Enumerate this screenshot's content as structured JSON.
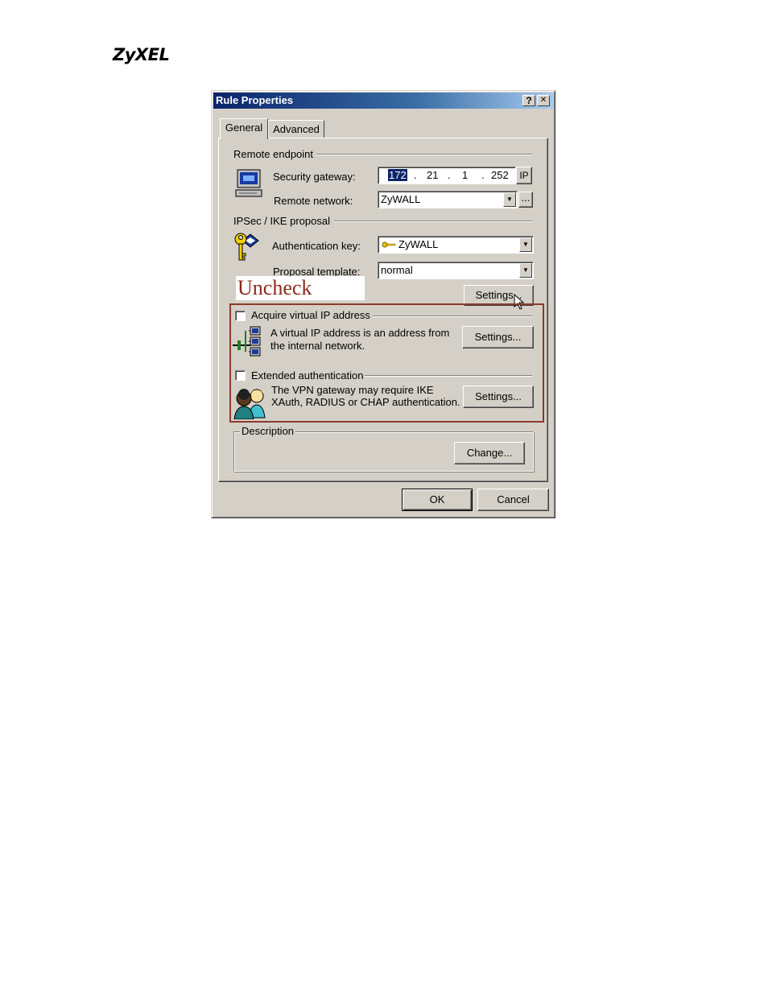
{
  "brand": {
    "logo": "ZyXEL"
  },
  "dialog": {
    "title": "Rule Properties",
    "help_glyph": "?",
    "close_glyph": "✕",
    "tabs": [
      {
        "label": "General",
        "active": true
      },
      {
        "label": "Advanced",
        "active": false
      }
    ],
    "remote_endpoint": {
      "group_label": "Remote endpoint",
      "security_gateway_label": "Security gateway:",
      "ip_octets": [
        "172",
        "21",
        "1",
        "252"
      ],
      "ip_separator": ".",
      "ip_type_label": "IP",
      "remote_network_label": "Remote network:",
      "remote_network_value": "ZyWALL",
      "browse_label": "..."
    },
    "ipsec": {
      "group_label": "IPSec / IKE proposal",
      "auth_key_label": "Authentication key:",
      "auth_key_value": "ZyWALL",
      "proposal_label": "Proposal template:",
      "proposal_value": "normal",
      "settings_label": "Settings..."
    },
    "annotation": {
      "text": "Uncheck",
      "color": "#8b2a1f"
    },
    "virtual_ip": {
      "checkbox_label": "Acquire virtual IP address",
      "checked": false,
      "description_line1": "A virtual IP address is an address from",
      "description_line2": "the internal network.",
      "settings_label": "Settings..."
    },
    "xauth": {
      "checkbox_label": "Extended authentication",
      "checked": false,
      "description_line1": "The VPN gateway may require IKE",
      "description_line2": "XAuth, RADIUS or CHAP authentication.",
      "settings_label": "Settings..."
    },
    "description": {
      "group_label": "Description",
      "change_label": "Change..."
    },
    "footer": {
      "ok_label": "OK",
      "cancel_label": "Cancel"
    }
  },
  "colors": {
    "title_start": "#0a246a",
    "title_end": "#a6caf0",
    "face": "#d4d0c8",
    "highlight_box": "#8b3a2b"
  }
}
